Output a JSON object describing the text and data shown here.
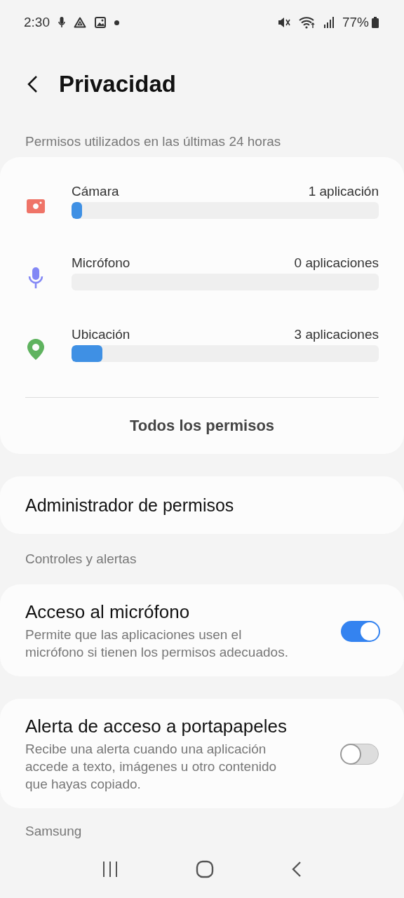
{
  "status_bar": {
    "time": "2:30",
    "battery": "77%"
  },
  "header": {
    "title": "Privacidad"
  },
  "usage_section": {
    "label": "Permisos utilizados en las últimas 24 horas",
    "permissions": [
      {
        "kind": "camera",
        "name": "Cámara",
        "count": "1 aplicación",
        "level": 0.035,
        "color": "#ef7468"
      },
      {
        "kind": "microphone",
        "name": "Micrófono",
        "count": "0 aplicaciones",
        "level": 0,
        "color": "#8287f5"
      },
      {
        "kind": "location",
        "name": "Ubicación",
        "count": "3 aplicaciones",
        "level": 0.1,
        "color": "#5fb35f"
      }
    ],
    "all_button": "Todos los permisos"
  },
  "manager": {
    "title": "Administrador de permisos"
  },
  "controls_section": {
    "label": "Controles y alertas",
    "items": [
      {
        "title": "Acceso al micrófono",
        "description": "Permite que las aplicaciones usen el micrófono si tienen los permisos adecuados.",
        "on": true
      },
      {
        "title": "Alerta de acceso a portapapeles",
        "description": "Recibe una alerta cuando una aplicación accede a texto, imágenes u otro contenido que hayas copiado.",
        "on": false
      }
    ]
  },
  "samsung_section": {
    "label": "Samsung"
  }
}
